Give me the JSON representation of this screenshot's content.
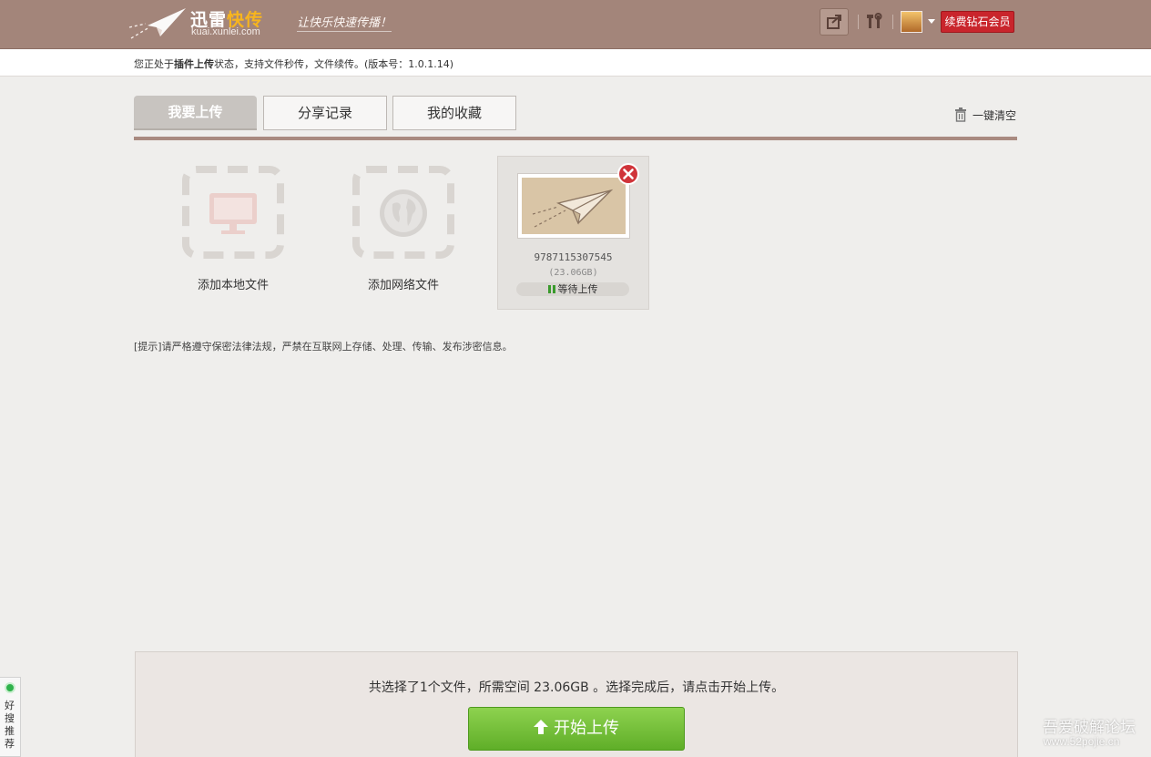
{
  "header": {
    "logo_text_a": "迅雷",
    "logo_text_b": "快传",
    "logo_domain": "kuai.xunlei.com",
    "slogan": "让快乐快速传播！",
    "vip_button": "续费钻石会员"
  },
  "status": {
    "prefix": "您正处于",
    "mode": "插件上传",
    "suffix": "状态，支持文件秒传，文件续传。(版本号：1.0.1.14)"
  },
  "tabs": [
    {
      "label": "我要上传"
    },
    {
      "label": "分享记录"
    },
    {
      "label": "我的收藏"
    }
  ],
  "clear_all": "一键清空",
  "add_tiles": [
    {
      "label": "添加本地文件",
      "icon": "monitor-icon"
    },
    {
      "label": "添加网络文件",
      "icon": "globe-icon"
    }
  ],
  "file": {
    "name": "9787115307545",
    "size": "(23.06GB)",
    "status": "等待上传"
  },
  "notice": "[提示]请严格遵守保密法律法规，严禁在互联网上存储、处理、传输、发布涉密信息。",
  "summary": "共选择了1个文件，所需空间 23.06GB 。选择完成后，请点击开始上传。",
  "start_button": "开始上传",
  "side_tab": "好搜推荐",
  "watermark": {
    "line1": "吾爱破解论坛",
    "line2": "www.52pojie.cn"
  },
  "colors": {
    "header_bg": "#a3857a",
    "accent_orange": "#f7b51e",
    "vip_red": "#c9252c",
    "start_green": "#6cbc34"
  }
}
